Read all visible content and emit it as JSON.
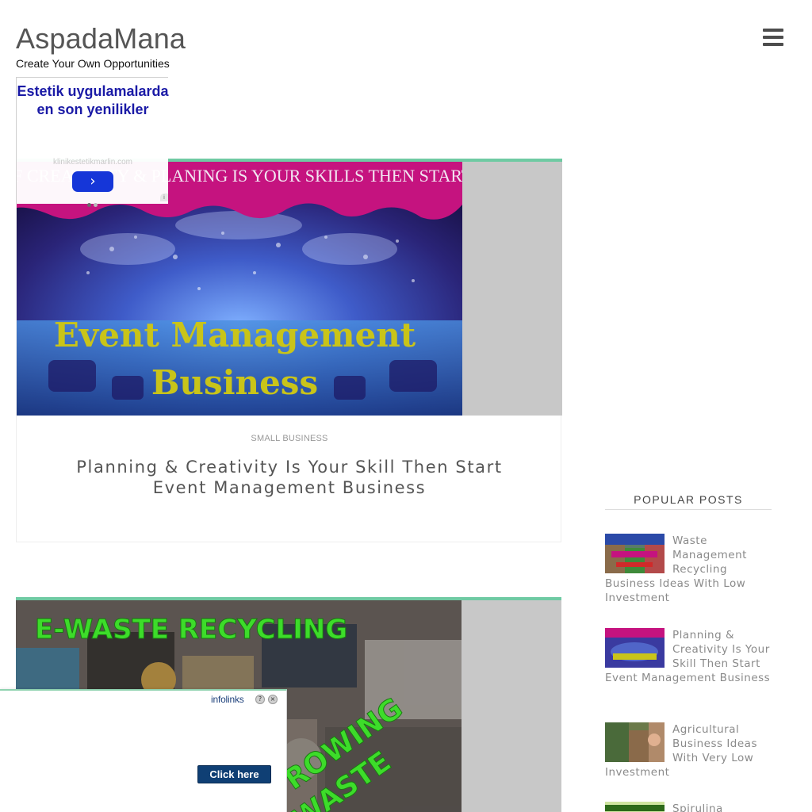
{
  "header": {
    "site_title": "AspadaMana",
    "tagline": "Create Your Own Opportunities",
    "menu_icon": "hamburger-menu-icon"
  },
  "posts": [
    {
      "image_caption_top": "IF CREATIVITY & PLANING IS YOUR SKILLS THEN START",
      "image_caption_main_1": "Event Management",
      "image_caption_main_2": "Business",
      "category": "SMALL BUSINESS",
      "title": "Planning & Creativity Is Your Skill Then Start Event Management Business"
    },
    {
      "image_caption_top": "E-WASTE RECYCLING",
      "image_caption_side_1": "ROWING",
      "image_caption_side_2": "WASTE"
    }
  ],
  "ad_top": {
    "text": "Estetik uygulamalarda en son yenilikler",
    "url": "klinikestetikmarlin.com",
    "arrow_icon": "chevron-right-icon"
  },
  "sidebar": {
    "popular_heading": "POPULAR POSTS",
    "items": [
      {
        "title": "Waste Management Recycling Business Ideas With Low Investment"
      },
      {
        "title": "Planning & Creativity Is Your Skill Then Start Event Management Business"
      },
      {
        "title": "Agricultural Business Ideas With Very Low Investment"
      },
      {
        "title": "Spirulina"
      }
    ]
  },
  "ad_bottom": {
    "brand": "infolinks",
    "help_label": "?",
    "close_label": "×",
    "cta": "Click here"
  },
  "colors": {
    "accent": "#6fcaa3",
    "ad_blue": "#1a1aa6",
    "cta_blue": "#0f3f74"
  }
}
